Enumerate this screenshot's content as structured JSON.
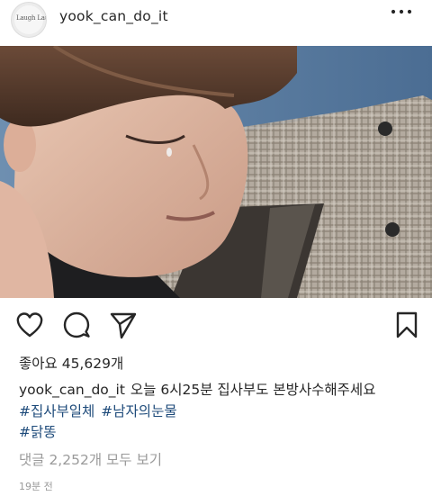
{
  "post": {
    "username": "yook_can_do_it",
    "avatar_text": "Laugh Laugh Laugh",
    "likes_label": "좋아요 45,629개",
    "caption": {
      "username": "yook_can_do_it",
      "text": "오늘 6시25분 집사부도 본방사수해주세요",
      "hashtags": [
        "#집사부일체",
        "#남자의눈물",
        "#닭똥"
      ]
    },
    "comments_label": "댓글 2,252개 모두 보기",
    "timestamp": "19분 전"
  },
  "icons": {
    "more": "more-dots-icon",
    "like": "heart-icon",
    "comment": "comment-bubble-icon",
    "share": "paper-plane-icon",
    "save": "bookmark-icon"
  },
  "colors": {
    "text": "#262626",
    "hashtag": "#1d4a7a",
    "muted": "#9a9a9a"
  }
}
